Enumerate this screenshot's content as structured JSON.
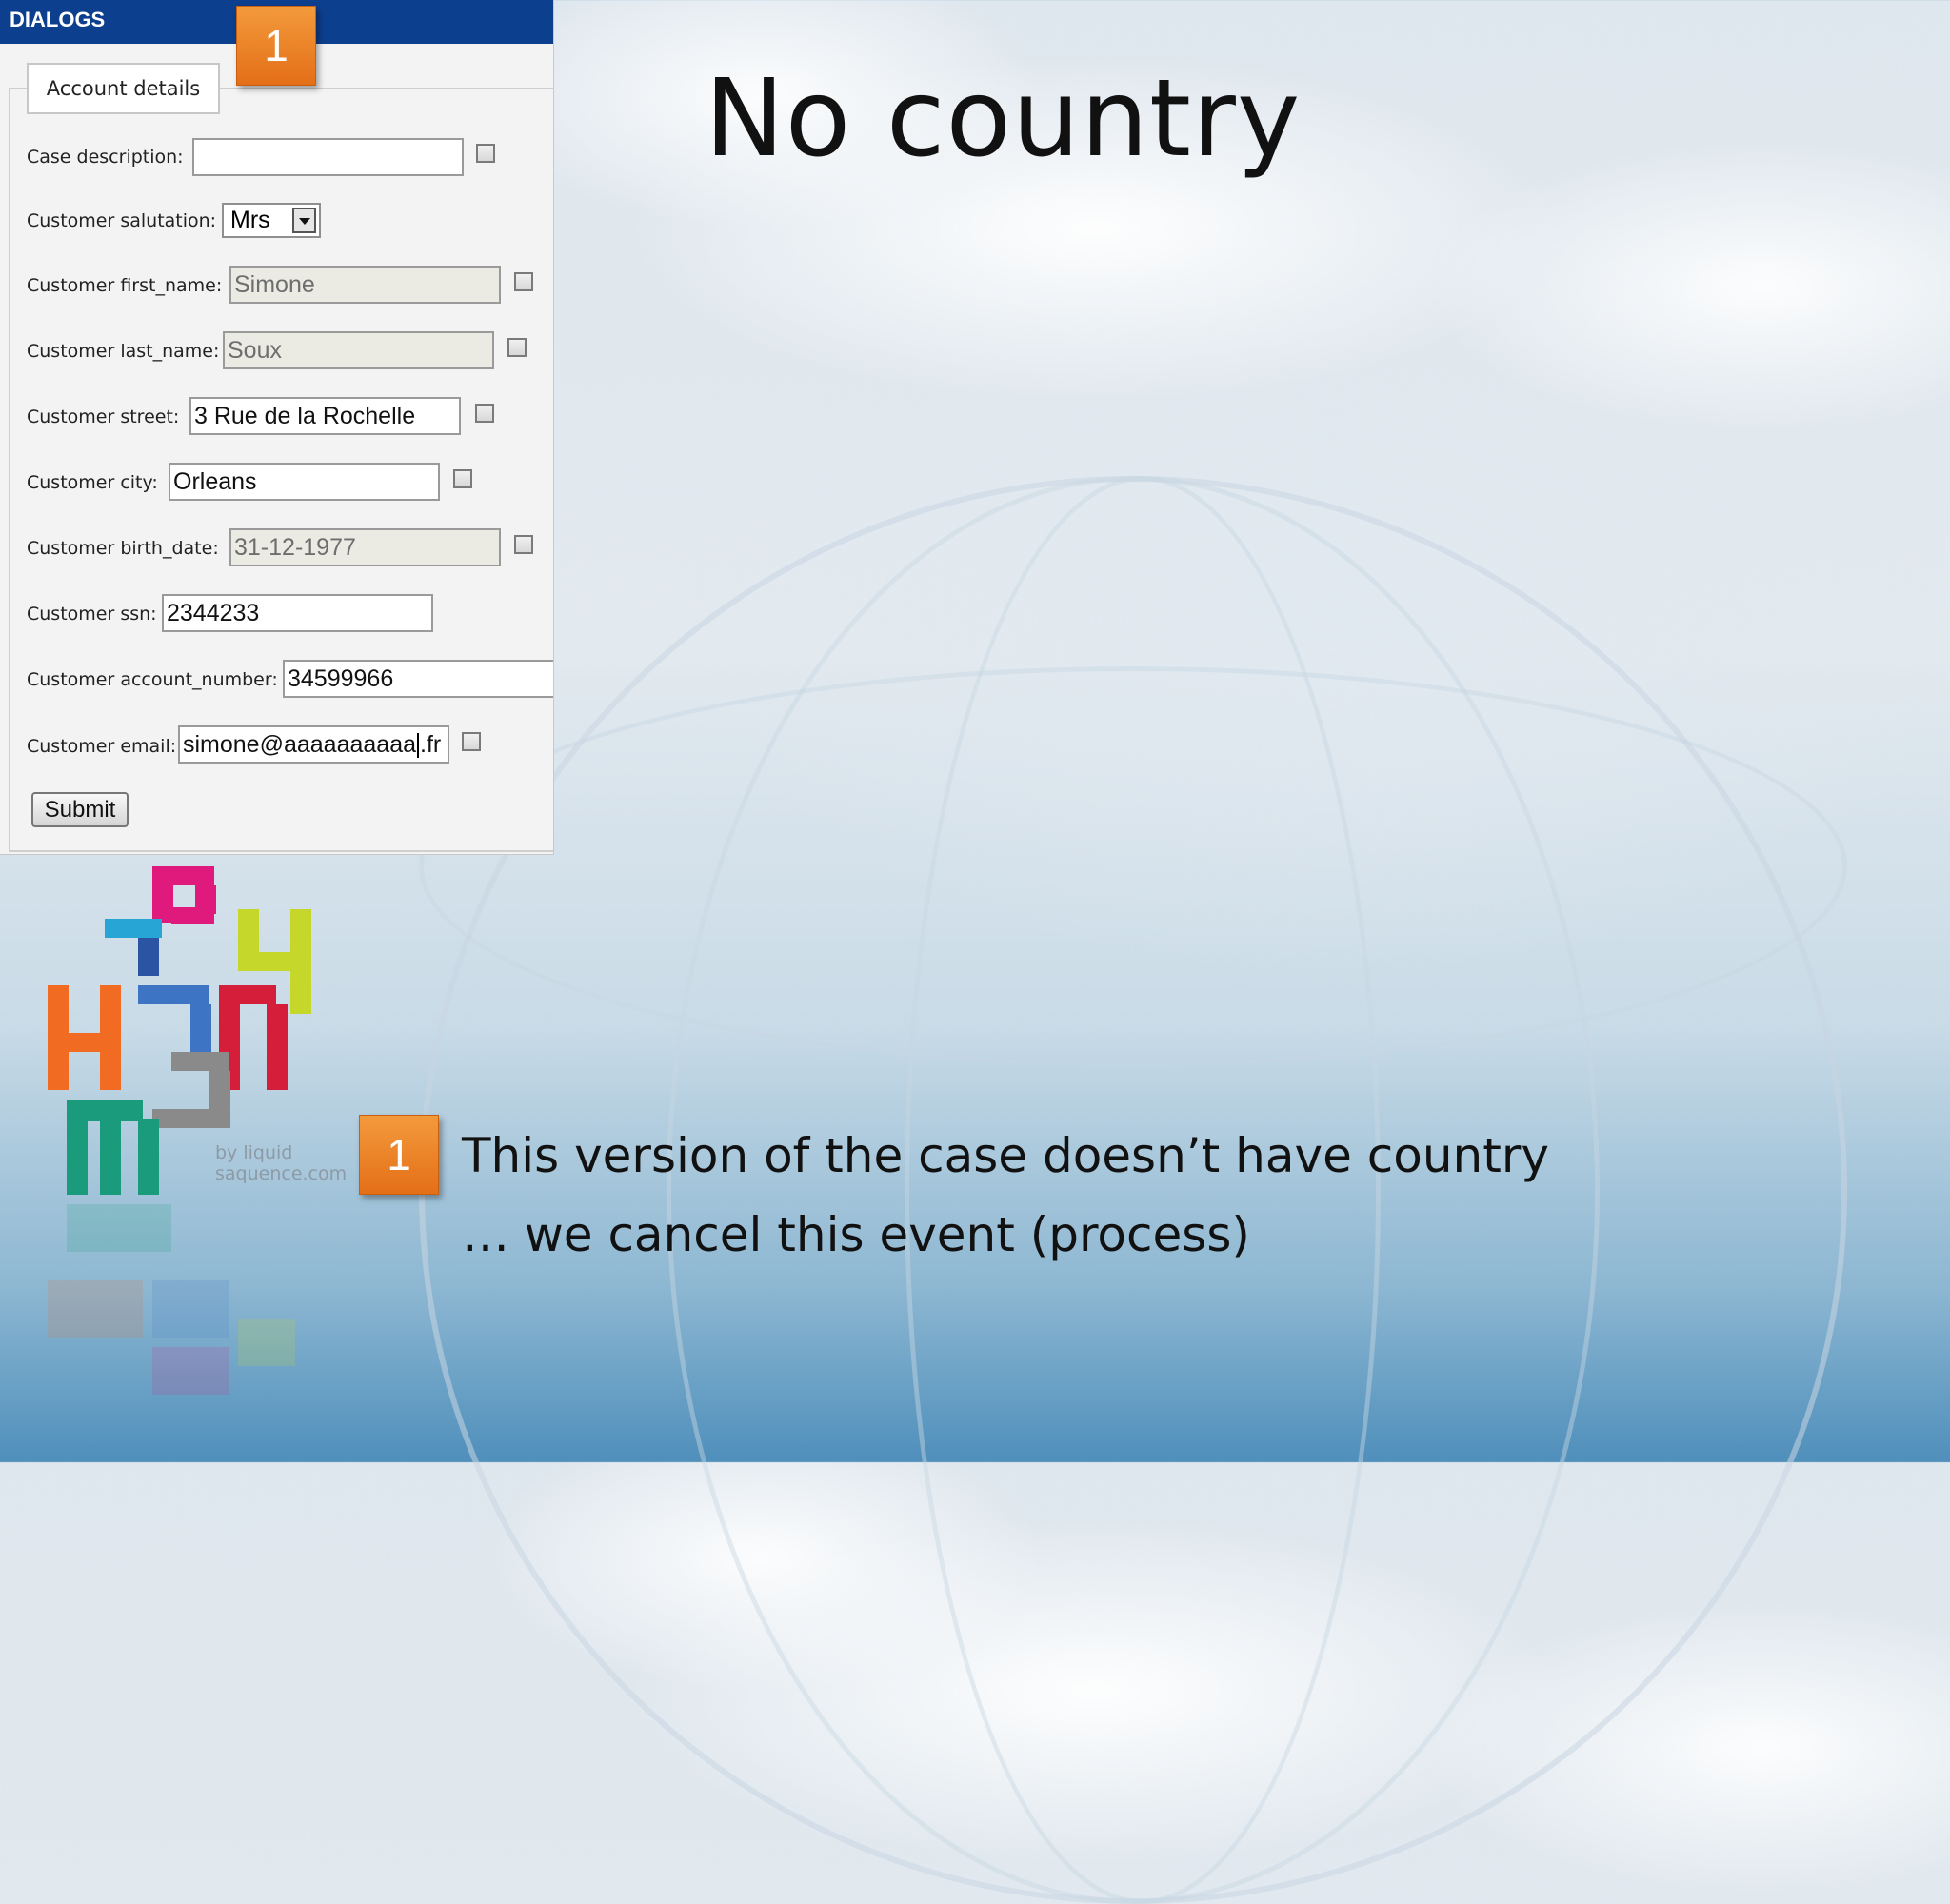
{
  "dialog": {
    "header_title": "DIALOGS",
    "tab_label": "Account details",
    "fields": [
      {
        "label": "Case description:",
        "value": "",
        "disabled": false,
        "has_checkbox": true
      },
      {
        "label": "Customer salutation:",
        "value": "Mrs",
        "type": "select"
      },
      {
        "label": "Customer first_name:",
        "value": "Simone",
        "disabled": true,
        "has_checkbox": true
      },
      {
        "label": "Customer last_name:",
        "value": "Soux",
        "disabled": true,
        "has_checkbox": true
      },
      {
        "label": "Customer street:",
        "value": "3 Rue de la Rochelle",
        "disabled": false,
        "has_checkbox": true
      },
      {
        "label": "Customer city:",
        "value": "Orleans",
        "disabled": false,
        "has_checkbox": true
      },
      {
        "label": "Customer birth_date:",
        "value": "31-12-1977",
        "disabled": true,
        "has_checkbox": true
      },
      {
        "label": "Customer ssn:",
        "value": "2344233",
        "disabled": false,
        "has_checkbox": false
      },
      {
        "label": "Customer account_number:",
        "value": "34599966",
        "disabled": false,
        "has_checkbox": false
      },
      {
        "label": "Customer email:",
        "value_before_caret": "simone@aaaaaaaaaa",
        "value_after_caret": ".fr",
        "disabled": false,
        "has_checkbox": true
      }
    ],
    "submit_label": "Submit"
  },
  "slide": {
    "title": "No country",
    "badge_number": "1",
    "callout_line1": "This version of the case doesn’t have country",
    "callout_line2": "… we cancel this event (process)"
  },
  "logo": {
    "byline_1": "by liquid",
    "byline_2": "saquence.com"
  },
  "colors": {
    "dialog_header": "#0d3f8f",
    "badge": "#e97a21"
  }
}
